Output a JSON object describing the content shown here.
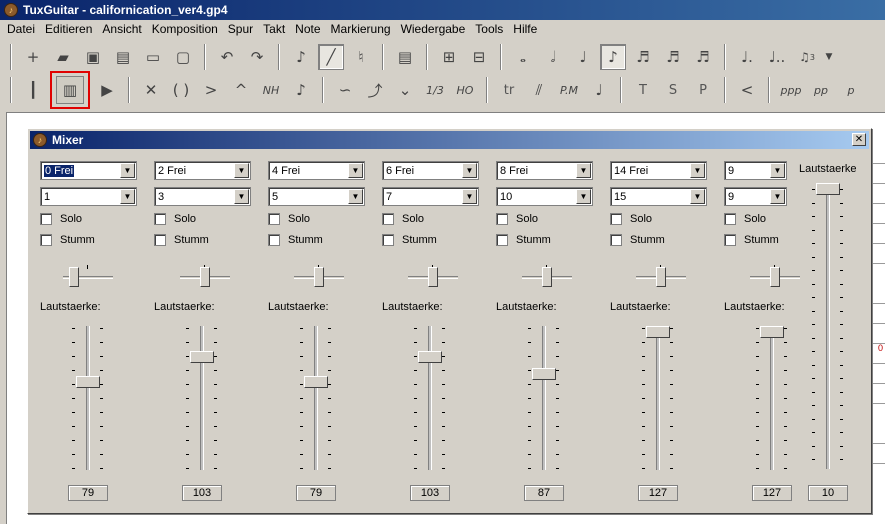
{
  "app": {
    "title": "TuxGuitar - californication_ver4.gp4"
  },
  "menu": [
    "Datei",
    "Editieren",
    "Ansicht",
    "Komposition",
    "Spur",
    "Takt",
    "Note",
    "Markierung",
    "Wiedergabe",
    "Tools",
    "Hilfe"
  ],
  "toolbar_text": {
    "natural_harmonic": "NH",
    "tuplet": "1/3",
    "hammer_on": "HO",
    "trill": "tr",
    "palm_mute": "P.M",
    "tapping": "T",
    "slapping": "S",
    "popping": "P",
    "dyn_ppp": "ppp",
    "dyn_pp": "pp",
    "dyn_p": "p",
    "tuplet_3": "3"
  },
  "mixer": {
    "title": "Mixer",
    "solo_label": "Solo",
    "mute_label": "Stumm",
    "volume_label": "Lautstaerke:",
    "master_label": "Lautstaerke",
    "master_volume": "10",
    "master_value": 10,
    "channels": [
      {
        "channel": "0 Frei",
        "effect": "1",
        "volume": "79",
        "vol_value": 79,
        "balance": 0.15,
        "selected": true
      },
      {
        "channel": "2 Frei",
        "effect": "3",
        "volume": "103",
        "vol_value": 103,
        "balance": 0.5
      },
      {
        "channel": "4 Frei",
        "effect": "5",
        "volume": "79",
        "vol_value": 79,
        "balance": 0.5
      },
      {
        "channel": "6 Frei",
        "effect": "7",
        "volume": "103",
        "vol_value": 103,
        "balance": 0.5
      },
      {
        "channel": "8 Frei",
        "effect": "10",
        "volume": "87",
        "vol_value": 87,
        "balance": 0.5
      },
      {
        "channel": "14 Frei",
        "effect": "15",
        "volume": "127",
        "vol_value": 127,
        "balance": 0.5
      },
      {
        "channel": "9",
        "effect": "9",
        "volume": "127",
        "vol_value": 127,
        "balance": 0.5
      }
    ]
  },
  "doc_fragment": "0"
}
